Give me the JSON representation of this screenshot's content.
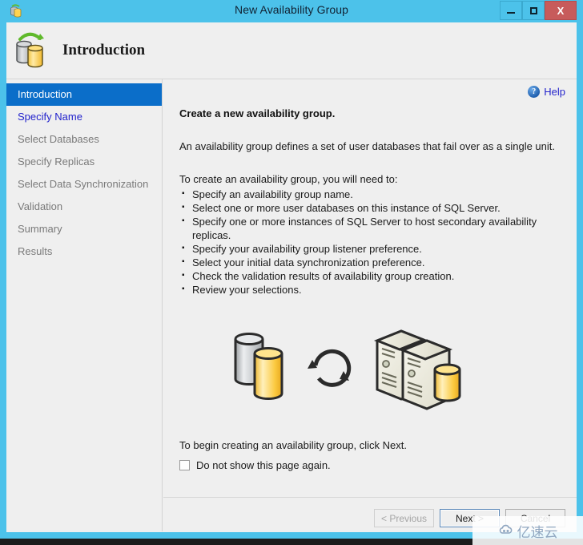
{
  "window": {
    "title": "New Availability Group",
    "icon": "availability-group-icon",
    "controls": {
      "minimize": "–",
      "maximize": "□",
      "close": "X"
    }
  },
  "header": {
    "title": "Introduction",
    "icon": "availability-group-icon"
  },
  "sidebar": {
    "items": [
      {
        "label": "Introduction",
        "state": "active"
      },
      {
        "label": "Specify Name",
        "state": "link"
      },
      {
        "label": "Select Databases",
        "state": "normal"
      },
      {
        "label": "Specify Replicas",
        "state": "normal"
      },
      {
        "label": "Select Data Synchronization",
        "state": "normal"
      },
      {
        "label": "Validation",
        "state": "normal"
      },
      {
        "label": "Summary",
        "state": "normal"
      },
      {
        "label": "Results",
        "state": "normal"
      }
    ]
  },
  "content": {
    "help": {
      "label": "Help",
      "icon": "help-question-icon"
    },
    "heading": "Create a new availability group.",
    "intro": "An availability group defines a set of user databases that fail over as a single unit.",
    "steps_lead": "To create an availability group, you will need to:",
    "steps": [
      "Specify an availability group name.",
      "Select one or more user databases on this instance of SQL Server.",
      "Specify one or more instances of SQL Server to host secondary availability replicas.",
      "Specify your availability group listener preference.",
      "Select your initial data synchronization preference.",
      "Check the validation results of availability group creation.",
      "Review your selections."
    ],
    "illustration": "databases-sync-servers-illustration",
    "closing": "To begin creating an availability group, click Next.",
    "dont_show": {
      "label": "Do not show this page again.",
      "checked": false
    }
  },
  "footer": {
    "previous": "< Previous",
    "next": "Next >",
    "cancel": "Cancel"
  },
  "watermark": {
    "text": "亿速云",
    "logo": "cloud-logo"
  },
  "colors": {
    "title_bar": "#4cc2ea",
    "close_button": "#c75b5b",
    "sidebar_active": "#0b6ec9",
    "link": "#2222cc",
    "client_bg": "#efefef"
  }
}
